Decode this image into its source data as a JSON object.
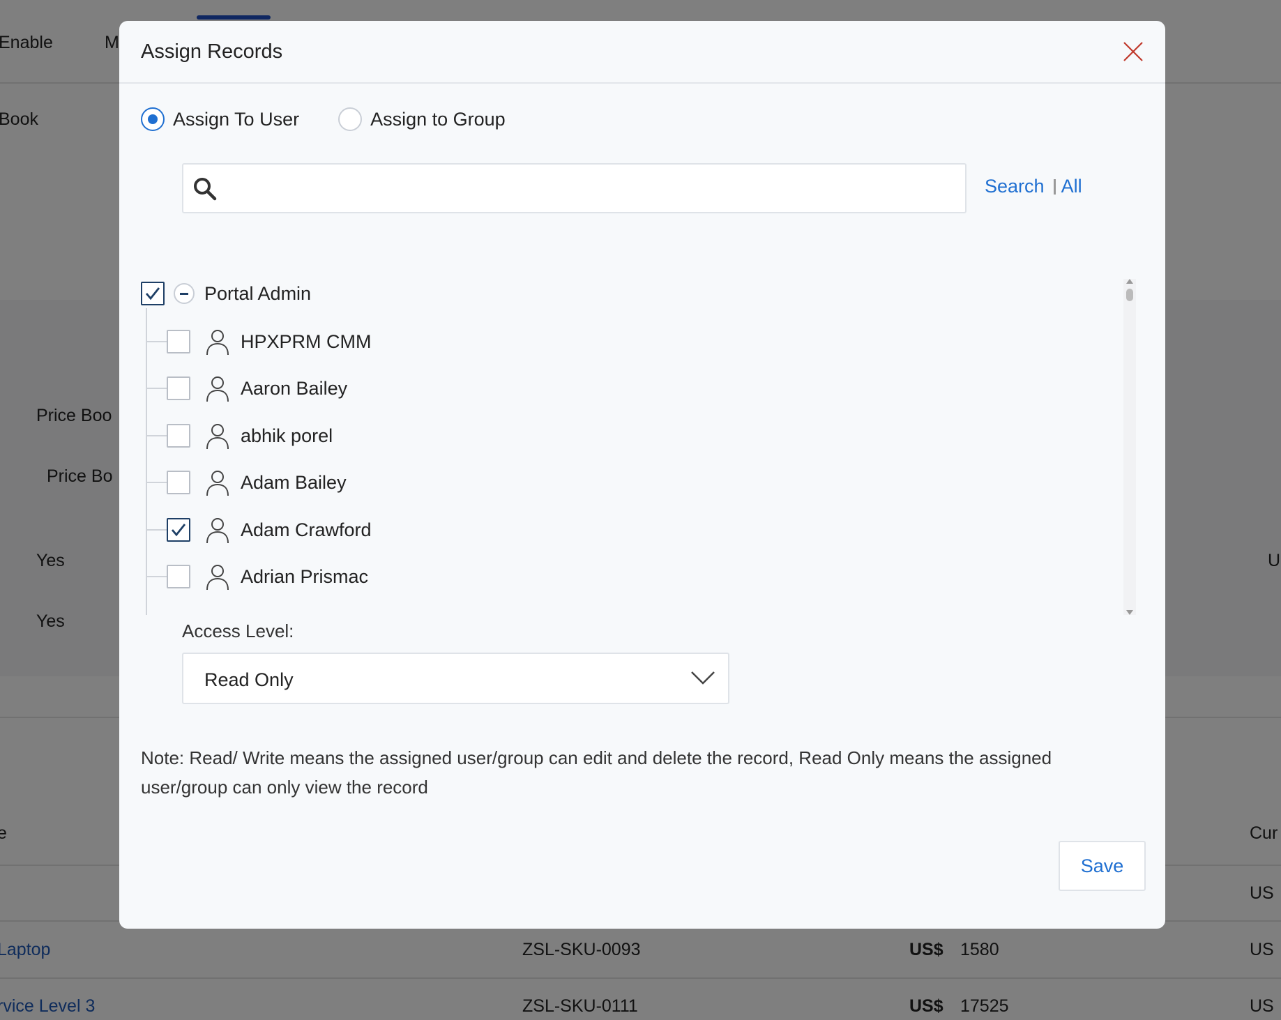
{
  "background": {
    "tab_partial_1": "Enable",
    "tab_partial_2": "M",
    "row_label_book": "Book",
    "field_price_book_1": "Price Boo",
    "field_price_book_2": "Price Bo",
    "value_yes_1": "Yes",
    "value_yes_2": "Yes",
    "right_edge_u": "U",
    "col_header_left": "e",
    "col_header_right": "Cur",
    "rows": [
      {
        "name": "",
        "sku": "",
        "currency_sym": "",
        "price": "",
        "currency": "US"
      },
      {
        "name": "Laptop",
        "sku": "ZSL-SKU-0093",
        "currency_sym": "US$",
        "price": "1580",
        "currency": "US"
      },
      {
        "name": "rvice Level 3",
        "sku": "ZSL-SKU-0111",
        "currency_sym": "US$",
        "price": "17525",
        "currency": "US"
      }
    ]
  },
  "modal": {
    "title": "Assign Records",
    "radio_options": [
      {
        "label": "Assign To User",
        "selected": true
      },
      {
        "label": "Assign to Group",
        "selected": false
      }
    ],
    "search": {
      "value": "",
      "placeholder": "",
      "search_link": "Search",
      "all_link": "All"
    },
    "tree": {
      "root": {
        "label": "Portal Admin",
        "checked": true
      },
      "users": [
        {
          "label": "HPXPRM CMM",
          "checked": false
        },
        {
          "label": "Aaron Bailey",
          "checked": false
        },
        {
          "label": "abhik porel",
          "checked": false
        },
        {
          "label": "Adam Bailey",
          "checked": false
        },
        {
          "label": "Adam Crawford",
          "checked": true
        },
        {
          "label": "Adrian Prismac",
          "checked": false
        }
      ]
    },
    "access_level": {
      "label": "Access Level:",
      "value": "Read Only"
    },
    "note": "Note: Read/ Write means the assigned user/group can edit and delete the record, Read Only means the assigned user/group can only view the record",
    "save_label": "Save"
  },
  "colors": {
    "accent_blue": "#1f6fd1",
    "check_navy": "#1e3f66",
    "close_red": "#c0392b",
    "link_blue": "#1f58b7"
  }
}
